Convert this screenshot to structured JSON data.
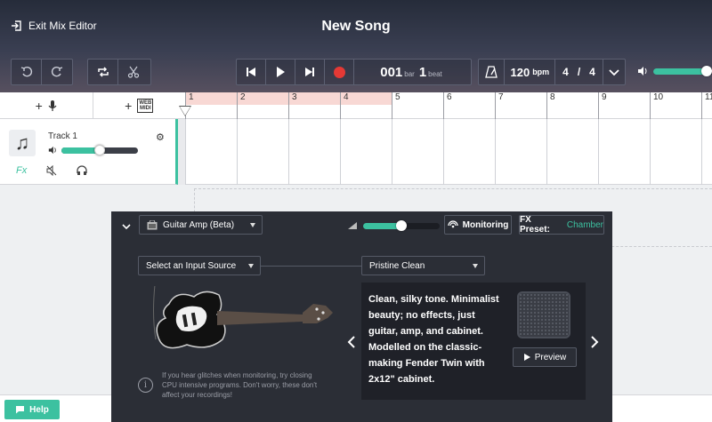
{
  "header": {
    "exit_label": "Exit Mix Editor",
    "song_title": "New Song"
  },
  "transport": {
    "bar_value": "001",
    "bar_label": "bar",
    "beat_value": "1",
    "beat_label": "beat"
  },
  "tempo": {
    "bpm_value": "120",
    "bpm_label": "bpm",
    "sig_top": "4",
    "sig_sep": "/",
    "sig_bottom": "4"
  },
  "master_volume": {
    "level": 0.72
  },
  "track_toolbar": {
    "web_midi_line1": "WEB",
    "web_midi_line2": "MIDI"
  },
  "ruler": {
    "ticks": [
      "1",
      "2",
      "3",
      "4",
      "5",
      "6",
      "7",
      "8",
      "9",
      "10",
      "11"
    ]
  },
  "track": {
    "name": "Track 1",
    "volume_level": 0.5,
    "fx_label": "Fx"
  },
  "amp": {
    "name": "Guitar Amp (Beta)",
    "volume_level": 0.5,
    "monitoring_label": "Monitoring",
    "fx_preset_label": "FX Preset:",
    "fx_preset_value": "Chamber",
    "input_source": "Select an Input Source",
    "preset": "Pristine Clean",
    "description": "Clean, silky tone. Minimalist beauty; no effects, just guitar, amp, and cabinet. Modelled on the classic-making Fender Twin with 2x12\" cabinet.",
    "preview_label": "Preview",
    "hint": "If you hear glitches when monitoring, try closing CPU intensive programs. Don't worry, these don't affect your recordings!"
  },
  "help_label": "Help",
  "colors": {
    "accent": "#3cc1a0",
    "record": "#e53935",
    "loop": "#f8d8d4"
  }
}
